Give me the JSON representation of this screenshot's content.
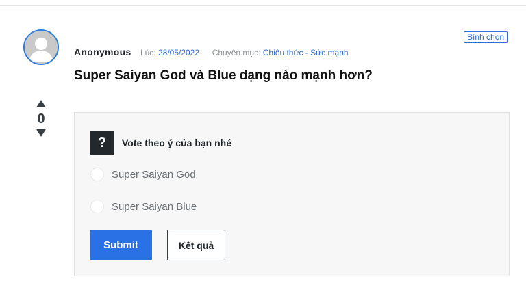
{
  "question": {
    "author": "Anonymous",
    "date_label": "Lúc:",
    "date": "28/05/2022",
    "category_label": "Chuyên mục:",
    "category": "Chiêu thức - Sức mạnh",
    "tag": "Bình chọn",
    "title": "Super Saiyan God và Blue dạng nào mạnh hơn?"
  },
  "votes": {
    "count": "0"
  },
  "poll": {
    "icon_glyph": "?",
    "prompt": "Vote theo ý của bạn nhé",
    "options": [
      {
        "label": "Super Saiyan God"
      },
      {
        "label": "Super Saiyan Blue"
      }
    ],
    "submit_label": "Submit",
    "results_label": "Kết quả"
  },
  "colors": {
    "accent": "#2b71e6",
    "link": "#2f6fd6",
    "avatar_ring": "#2f7bd9",
    "dark": "#23282d"
  }
}
